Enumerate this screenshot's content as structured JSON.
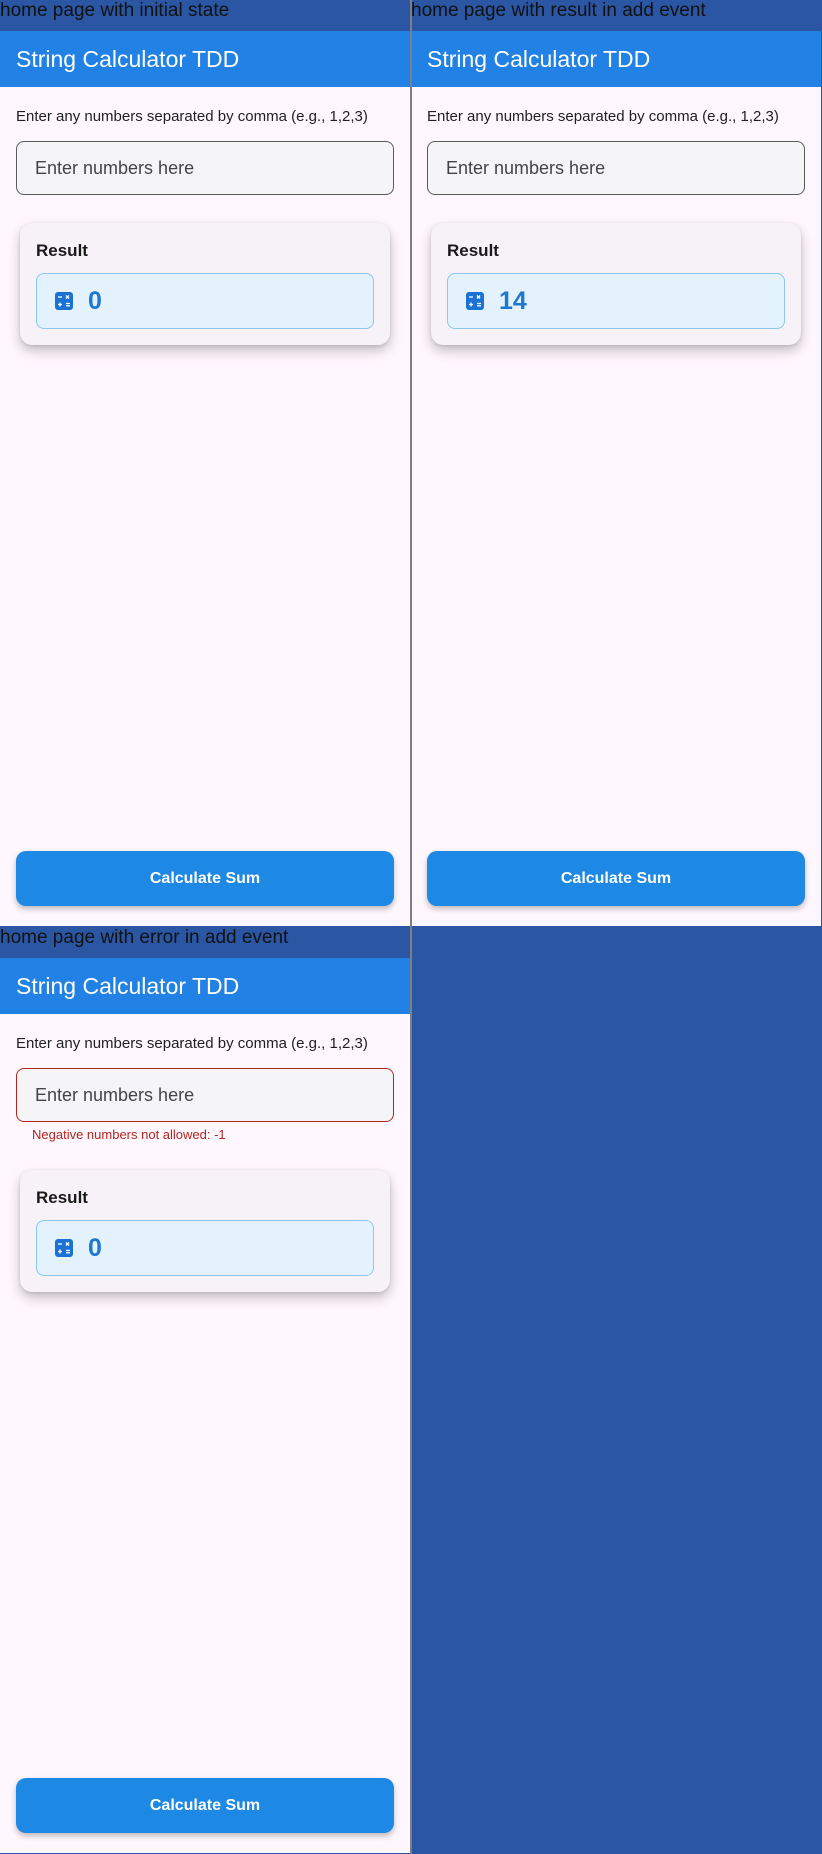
{
  "panels": [
    {
      "caption": "home page with initial state",
      "app_title": "String Calculator TDD",
      "helper_text": "Enter any numbers separated by comma (e.g., 1,2,3)",
      "input_placeholder": "Enter numbers here",
      "result_label": "Result",
      "result_value": "0",
      "button_label": "Calculate Sum"
    },
    {
      "caption": "home page with result in add event",
      "app_title": "String Calculator TDD",
      "helper_text": "Enter any numbers separated by comma (e.g., 1,2,3)",
      "input_placeholder": "Enter numbers here",
      "result_label": "Result",
      "result_value": "14",
      "button_label": "Calculate Sum"
    },
    {
      "caption": "home page with error in add event",
      "app_title": "String Calculator TDD",
      "helper_text": "Enter any numbers separated by comma (e.g., 1,2,3)",
      "input_placeholder": "Enter numbers here",
      "error_text": "Negative numbers not allowed: -1",
      "result_label": "Result",
      "result_value": "0",
      "button_label": "Calculate Sum"
    }
  ],
  "colors": {
    "background": "#2a56a4",
    "app_bar": "#2181e4",
    "button": "#1e88e5",
    "result_box": "#e3f2fd",
    "error": "#b3261e"
  }
}
